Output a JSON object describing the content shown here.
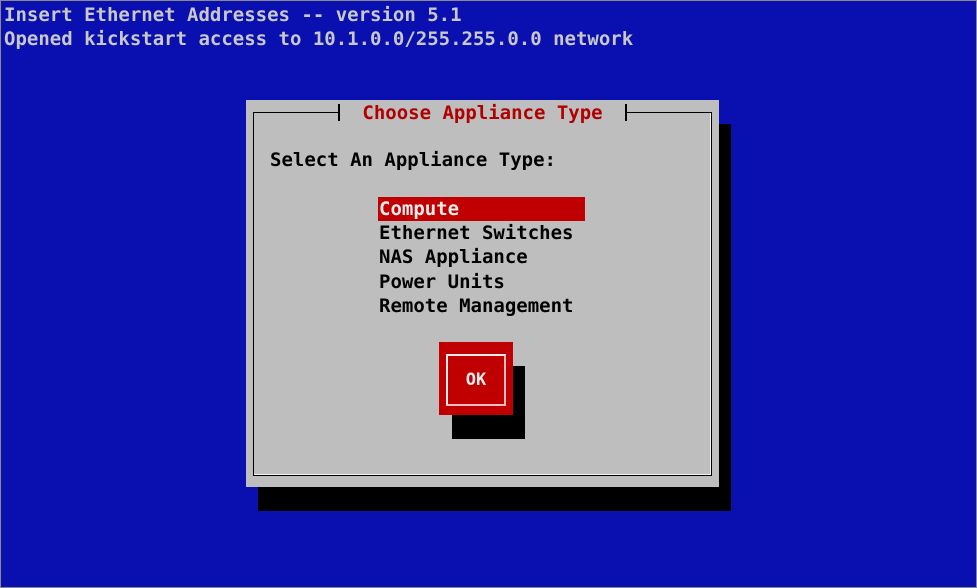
{
  "screen": {
    "line1": "Insert Ethernet Addresses -- version 5.1",
    "line2": "Opened kickstart access to 10.1.0.0/255.255.0.0 network"
  },
  "dialog": {
    "title": "Choose Appliance Type",
    "prompt": "Select An Appliance Type:",
    "items": [
      {
        "label": "Compute",
        "selected": true
      },
      {
        "label": "Ethernet Switches",
        "selected": false
      },
      {
        "label": "NAS Appliance",
        "selected": false
      },
      {
        "label": "Power Units",
        "selected": false
      },
      {
        "label": "Remote Management",
        "selected": false
      }
    ],
    "ok_label": "OK"
  },
  "colors": {
    "screen_background": "#0a0fb0",
    "dialog_background": "#bebebe",
    "highlight": "#c00000",
    "title_text": "#b00000"
  }
}
